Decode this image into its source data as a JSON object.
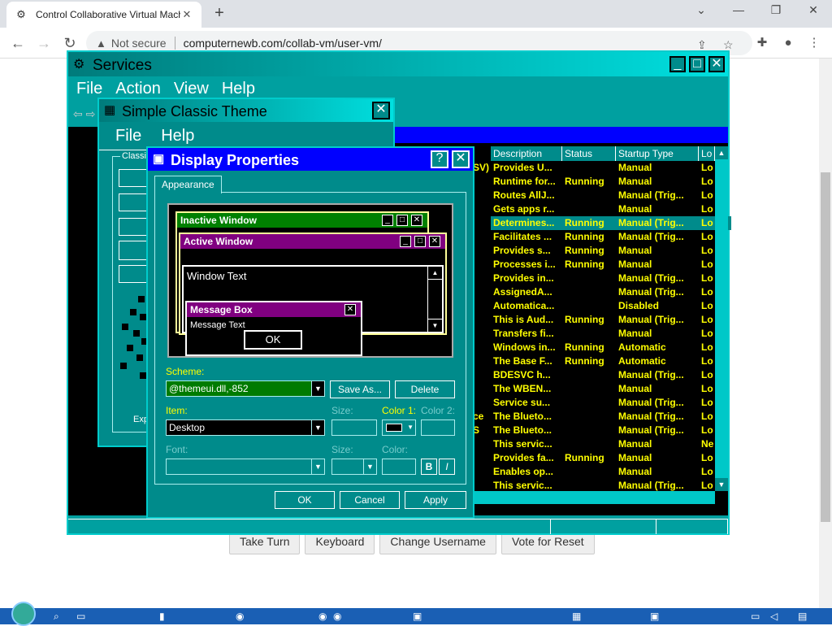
{
  "browser": {
    "tab_title": "Control Collaborative Virtual Machine",
    "tab_close": "✕",
    "new_tab": "+",
    "not_secure": "Not secure",
    "url": "computernewb.com/collab-vm/user-vm/"
  },
  "page_buttons": [
    "Take Turn",
    "Keyboard",
    "Change Username",
    "Vote for Reset"
  ],
  "services": {
    "title": "Services",
    "menu": [
      "File",
      "Action",
      "View",
      "Help"
    ],
    "columns": [
      "Description",
      "Status",
      "Startup Type",
      "Lo"
    ],
    "rows": [
      {
        "name": "SV)",
        "desc": "Provides U...",
        "status": "",
        "startup": "Manual",
        "lo": "Lo"
      },
      {
        "name": "",
        "desc": "Runtime for...",
        "status": "Running",
        "startup": "Manual",
        "lo": "Lo"
      },
      {
        "name": "",
        "desc": "Routes AllJ...",
        "status": "",
        "startup": "Manual (Trig...",
        "lo": "Lo"
      },
      {
        "name": "",
        "desc": "Gets apps r...",
        "status": "",
        "startup": "Manual",
        "lo": "Lo"
      },
      {
        "name": "",
        "desc": "Determines...",
        "status": "Running",
        "startup": "Manual (Trig...",
        "lo": "Lo"
      },
      {
        "name": "",
        "desc": "Facilitates ...",
        "status": "Running",
        "startup": "Manual (Trig...",
        "lo": "Lo"
      },
      {
        "name": "",
        "desc": "Provides s...",
        "status": "Running",
        "startup": "Manual",
        "lo": "Lo"
      },
      {
        "name": "",
        "desc": "Processes i...",
        "status": "Running",
        "startup": "Manual",
        "lo": "Lo"
      },
      {
        "name": "",
        "desc": "Provides in...",
        "status": "",
        "startup": "Manual (Trig...",
        "lo": "Lo"
      },
      {
        "name": "",
        "desc": "AssignedA...",
        "status": "",
        "startup": "Manual (Trig...",
        "lo": "Lo"
      },
      {
        "name": "",
        "desc": "Automatica...",
        "status": "",
        "startup": "Disabled",
        "lo": "Lo"
      },
      {
        "name": "",
        "desc": "This is Aud...",
        "status": "Running",
        "startup": "Manual (Trig...",
        "lo": "Lo"
      },
      {
        "name": "",
        "desc": "Transfers fi...",
        "status": "",
        "startup": "Manual",
        "lo": "Lo"
      },
      {
        "name": "",
        "desc": "Windows in...",
        "status": "Running",
        "startup": "Automatic",
        "lo": "Lo"
      },
      {
        "name": "",
        "desc": "The Base F...",
        "status": "Running",
        "startup": "Automatic",
        "lo": "Lo"
      },
      {
        "name": "",
        "desc": "BDESVC h...",
        "status": "",
        "startup": "Manual (Trig...",
        "lo": "Lo"
      },
      {
        "name": "",
        "desc": "The WBEN...",
        "status": "",
        "startup": "Manual",
        "lo": "Lo"
      },
      {
        "name": "",
        "desc": "Service su...",
        "status": "",
        "startup": "Manual (Trig...",
        "lo": "Lo"
      },
      {
        "name": "ce",
        "desc": "The Blueto...",
        "status": "",
        "startup": "Manual (Trig...",
        "lo": "Lo"
      },
      {
        "name": "S",
        "desc": "The Blueto...",
        "status": "",
        "startup": "Manual (Trig...",
        "lo": "Lo"
      },
      {
        "name": "",
        "desc": "This servic...",
        "status": "",
        "startup": "Manual",
        "lo": "Ne"
      },
      {
        "name": "",
        "desc": "Provides fa...",
        "status": "Running",
        "startup": "Manual",
        "lo": "Lo"
      },
      {
        "name": "",
        "desc": "Enables op...",
        "status": "",
        "startup": "Manual",
        "lo": "Lo"
      },
      {
        "name": "",
        "desc": "This servic...",
        "status": "",
        "startup": "Manual (Trig...",
        "lo": "Lo"
      }
    ]
  },
  "simple_classic": {
    "title": "Simple Classic Theme",
    "menu": [
      "File",
      "Help"
    ],
    "group": "Classic",
    "exp": "Exp"
  },
  "display_props": {
    "title": "Display Properties",
    "help_btn": "?",
    "close_btn": "✕",
    "tab": "Appearance",
    "preview": {
      "inactive": "Inactive Window",
      "active": "Active Window",
      "window_text": "Window Text",
      "message_box": "Message Box",
      "message_text": "Message Text",
      "ok": "OK"
    },
    "scheme_label": "Scheme:",
    "scheme_value": "@themeui.dll,-852",
    "save_as": "Save As...",
    "delete": "Delete",
    "item_label": "Item:",
    "item_value": "Desktop",
    "size_label": "Size:",
    "color1_label": "Color 1:",
    "color2_label": "Color 2:",
    "font_label": "Font:",
    "font_size_label": "Size:",
    "font_color_label": "Color:",
    "bold": "B",
    "italic": "I",
    "ok": "OK",
    "cancel": "Cancel",
    "apply": "Apply"
  },
  "colors": {
    "teal": "#008b8b",
    "yellow_text": "#ffff00",
    "dialog_blue": "#0000ff",
    "inactive_green": "#008000",
    "active_purple": "#800080"
  }
}
